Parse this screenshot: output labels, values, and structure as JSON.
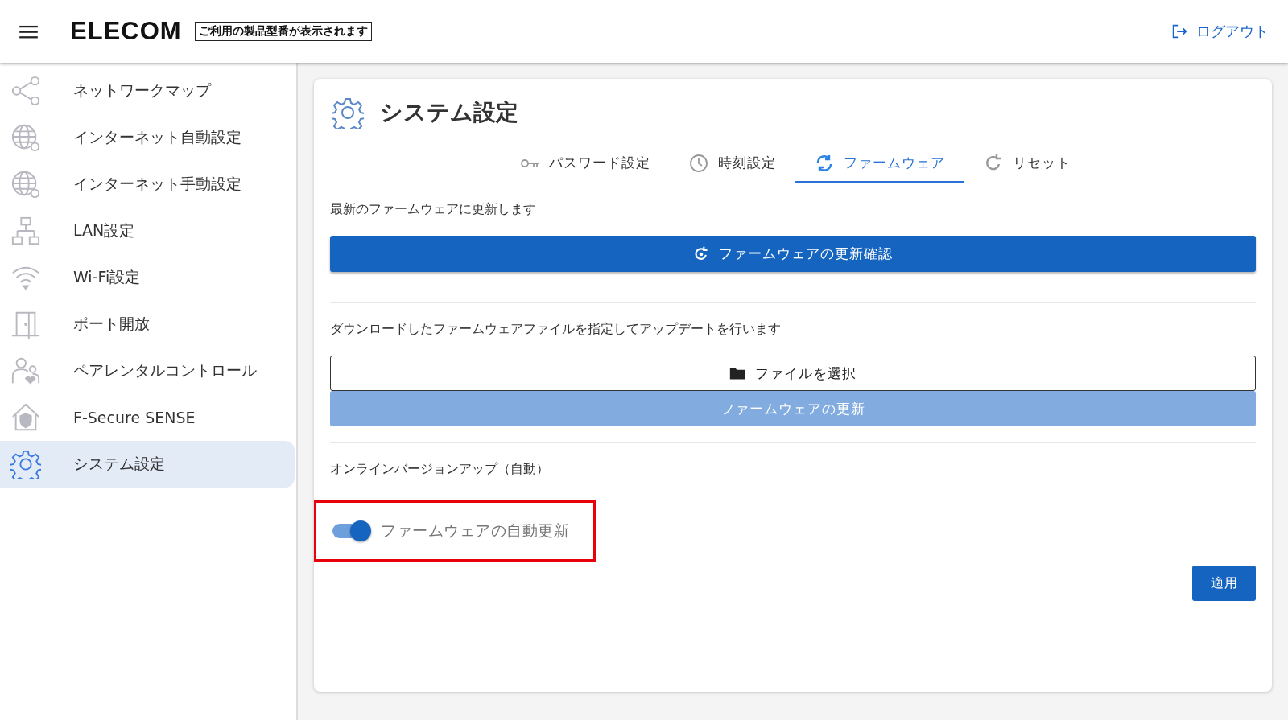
{
  "header": {
    "logo": "ELECOM",
    "model_label": "ご利用の製品型番が表示されます",
    "logout": "ログアウト"
  },
  "sidebar": {
    "items": [
      {
        "label": "ネットワークマップ",
        "selected": false
      },
      {
        "label": "インターネット自動設定",
        "selected": false
      },
      {
        "label": "インターネット手動設定",
        "selected": false
      },
      {
        "label": "LAN設定",
        "selected": false
      },
      {
        "label": "Wi-Fi設定",
        "selected": false
      },
      {
        "label": "ポート開放",
        "selected": false
      },
      {
        "label": "ペアレンタルコントロール",
        "selected": false
      },
      {
        "label": "F-Secure SENSE",
        "selected": false
      },
      {
        "label": "システム設定",
        "selected": true
      }
    ]
  },
  "page": {
    "title": "システム設定",
    "tabs": [
      {
        "label": "パスワード設定",
        "selected": false
      },
      {
        "label": "時刻設定",
        "selected": false
      },
      {
        "label": "ファームウェア",
        "selected": true
      },
      {
        "label": "リセット",
        "selected": false
      }
    ],
    "check_section": {
      "description": "最新のファームウェアに更新します",
      "button": "ファームウェアの更新確認"
    },
    "file_section": {
      "description": "ダウンロードしたファームウェアファイルを指定してアップデートを行います",
      "choose_button": "ファイルを選択",
      "update_button": {
        "label": "ファームウェアの更新",
        "disabled": true
      }
    },
    "auto_section": {
      "description": "オンラインバージョンアップ（自動）",
      "toggle": {
        "label": "ファームウェアの自動更新",
        "on": true,
        "highlighted": true
      }
    },
    "apply_button": "適用"
  }
}
